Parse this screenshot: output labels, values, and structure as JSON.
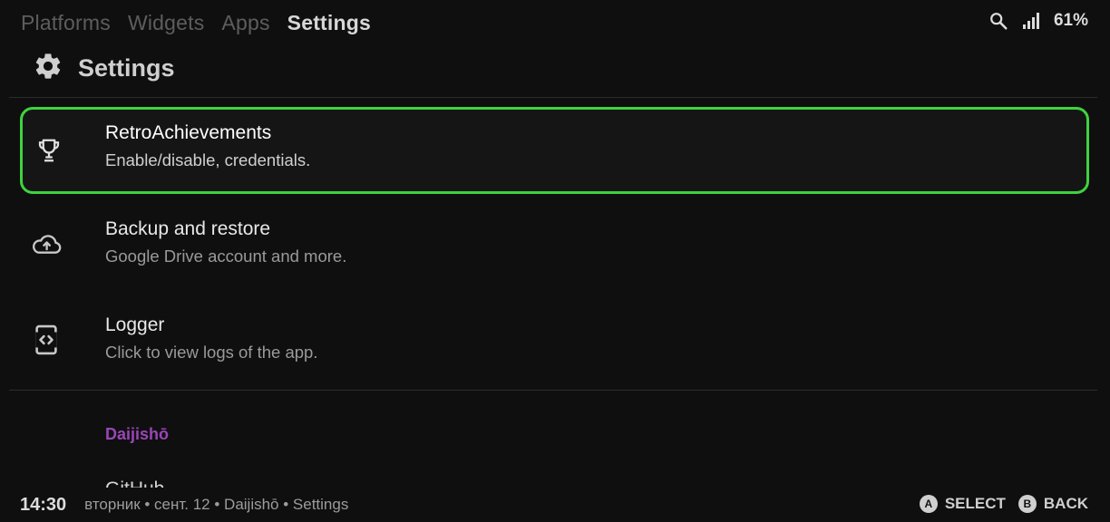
{
  "tabs": [
    {
      "label": "Platforms",
      "active": false
    },
    {
      "label": "Widgets",
      "active": false
    },
    {
      "label": "Apps",
      "active": false
    },
    {
      "label": "Settings",
      "active": true
    }
  ],
  "status": {
    "battery_percent": "61%",
    "search_icon": "search-icon",
    "signal_icon": "signal-icon"
  },
  "page": {
    "title": "Settings",
    "icon": "gear-icon"
  },
  "items": [
    {
      "label": "RetroAchievements",
      "sub": "Enable/disable, credentials.",
      "icon": "trophy-icon",
      "selected": true
    },
    {
      "label": "Backup and restore",
      "sub": "Google Drive account and more.",
      "icon": "cloud-upload-icon",
      "selected": false
    },
    {
      "label": "Logger",
      "sub": "Click to view logs of the app.",
      "icon": "logger-icon",
      "selected": false
    }
  ],
  "section": {
    "label": "Daijishō"
  },
  "partial_item": {
    "label": "GitHub"
  },
  "bottom": {
    "time": "14:30",
    "breadcrumb": "вторник • сент. 12 • Daijishō • Settings",
    "hint_a_button": "A",
    "hint_a_label": "SELECT",
    "hint_b_button": "B",
    "hint_b_label": "BACK"
  },
  "colors": {
    "accent_selected": "#3ed33e",
    "section": "#9a45b8",
    "background": "#0f0f0f"
  }
}
